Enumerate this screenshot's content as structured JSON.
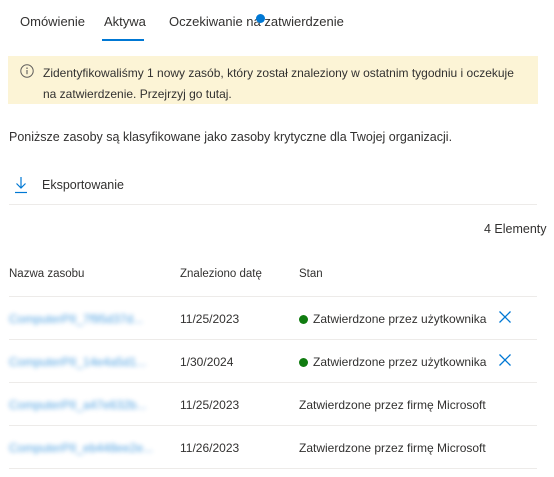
{
  "tabs": [
    {
      "label": "Omówienie"
    },
    {
      "label": "Aktywa"
    },
    {
      "label": "Oczekiwanie na zatwierdzenie"
    }
  ],
  "banner": {
    "text_prefix": "Zidentyfikowaliśmy 1 nowy zasób, który został znaleziony w ostatnim tygodniu i oczekuje na zatwierdzenie. ",
    "link": "Przejrzyj go tutaj."
  },
  "intro": "Poniższe zasoby są klasyfikowane jako zasoby krytyczne dla Twojej organizacji.",
  "toolbar": {
    "export_label": "Eksportowanie"
  },
  "count": "4 Elementy",
  "table": {
    "headers": [
      "Nazwa zasobu",
      "Znaleziono datę",
      "Stan"
    ],
    "rows": [
      {
        "name": "ComputerPII_7f95d37d...",
        "date": "11/25/2023",
        "status": "Zatwierdzone przez użytkownika"
      },
      {
        "name": "ComputerPII_14e4a5d1...",
        "date": "1/30/2024",
        "status": "Zatwierdzone przez użytkownika"
      },
      {
        "name": "ComputerPII_a47e632b...",
        "date": "11/25/2023",
        "status": "Zatwierdzone przez firmę Microsoft"
      },
      {
        "name": "ComputerPII_eb448ee2e...",
        "date": "11/26/2023",
        "status": "Zatwierdzone przez firmę Microsoft"
      }
    ]
  },
  "colors": {
    "accent": "#0078d4",
    "status_ok": "#107c10",
    "banner_bg": "#fcf4d6"
  },
  "icons": {
    "banner": "info-icon",
    "export": "download-icon",
    "row_action": "close-icon"
  }
}
